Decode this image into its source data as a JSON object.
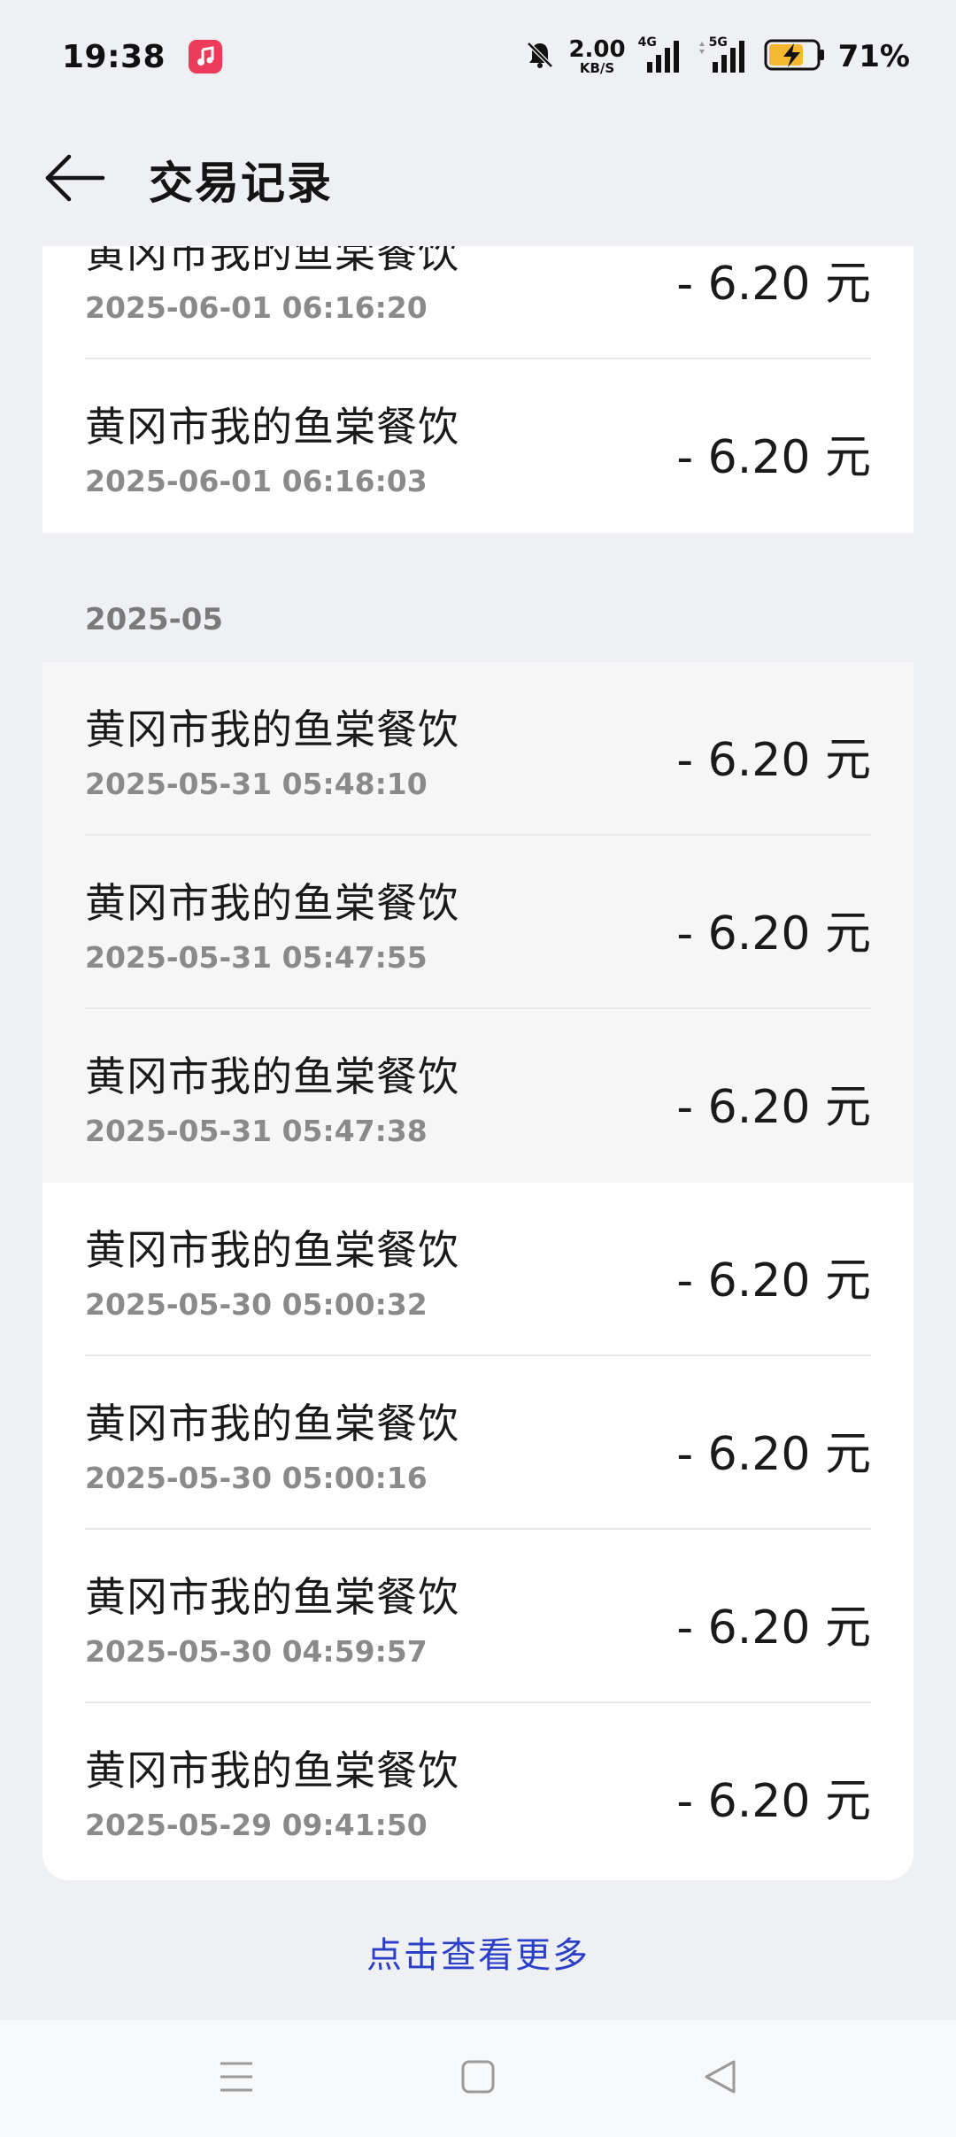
{
  "status_bar": {
    "time": "19:38",
    "net_speed_value": "2.00",
    "net_speed_unit": "KB/S",
    "sim1_tag": "4G",
    "sim2_tag": "5G",
    "battery_percent": "71%"
  },
  "header": {
    "title": "交易记录"
  },
  "top_group": {
    "rows": [
      {
        "merchant": "黄冈市我的鱼棠餐饮",
        "datetime": "2025-06-01 06:16:20",
        "amount": "- 6.20 元"
      },
      {
        "merchant": "黄冈市我的鱼棠餐饮",
        "datetime": "2025-06-01 06:16:03",
        "amount": "- 6.20 元"
      }
    ]
  },
  "may_group": {
    "month": "2025-05",
    "rows": [
      {
        "merchant": "黄冈市我的鱼棠餐饮",
        "datetime": "2025-05-31 05:48:10",
        "amount": "- 6.20 元"
      },
      {
        "merchant": "黄冈市我的鱼棠餐饮",
        "datetime": "2025-05-31 05:47:55",
        "amount": "- 6.20 元"
      },
      {
        "merchant": "黄冈市我的鱼棠餐饮",
        "datetime": "2025-05-31 05:47:38",
        "amount": "- 6.20 元"
      },
      {
        "merchant": "黄冈市我的鱼棠餐饮",
        "datetime": "2025-05-30 05:00:32",
        "amount": "- 6.20 元"
      },
      {
        "merchant": "黄冈市我的鱼棠餐饮",
        "datetime": "2025-05-30 05:00:16",
        "amount": "- 6.20 元"
      },
      {
        "merchant": "黄冈市我的鱼棠餐饮",
        "datetime": "2025-05-30 04:59:57",
        "amount": "- 6.20 元"
      },
      {
        "merchant": "黄冈市我的鱼棠餐饮",
        "datetime": "2025-05-29 09:41:50",
        "amount": "- 6.20 元"
      }
    ]
  },
  "footer": {
    "more_label": "点击查看更多"
  },
  "colors": {
    "background": "#eef0f3",
    "card": "#ffffff",
    "pressed_row": "#f6f6f7",
    "link": "#2b3fc9",
    "music_app": "#ee3b5b",
    "battery_charge": "#f5b82e"
  },
  "icons": {
    "back": "arrow-left-icon",
    "music_app": "music-app-icon",
    "mute": "bell-off-icon",
    "battery": "battery-charging-icon",
    "nav_menu": "menu-lines-icon",
    "nav_home": "square-home-icon",
    "nav_back": "triangle-back-icon"
  }
}
